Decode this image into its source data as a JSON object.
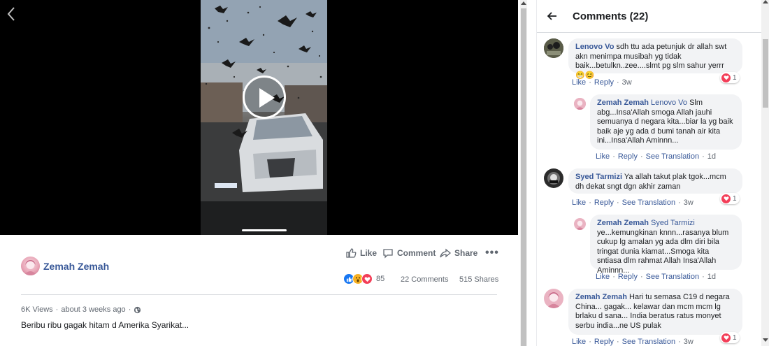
{
  "post": {
    "author": "Zemah Zemah",
    "actions": {
      "like": "Like",
      "comment": "Comment",
      "share": "Share"
    },
    "reaction_count": "85",
    "comments_count": "22 Comments",
    "shares_count": "515 Shares",
    "views": "6K Views",
    "time": "about 3 weeks ago",
    "caption": "Beribu ribu gagak hitam d Amerika Syarikat..."
  },
  "panel": {
    "title": "Comments (22)"
  },
  "comments": [
    {
      "author": "Lenovo Vo",
      "text": "sdh ttu ada petunjuk dr allah swt akn menimpa musibah yg tidak baik...betulkn..zee....slmt pg slm sahur yerrr 😁😊",
      "like": "Like",
      "reply": "Reply",
      "time": "3w",
      "reactions": "1"
    },
    {
      "author": "Zemah Zemah",
      "mention": "Lenovo Vo",
      "text": "Slm abg...Insa'Allah smoga Allah jauhi semuanya d negara kita...biar la yg baik baik aje yg ada d bumi tanah air kita ini...Insa'Allah Aminnn...",
      "like": "Like",
      "reply": "Reply",
      "translate": "See Translation",
      "time": "1d"
    },
    {
      "author": "Syed Tarmizi",
      "text": "Ya allah takut plak tgok...mcm dh dekat sngt dgn akhir zaman",
      "like": "Like",
      "reply": "Reply",
      "translate": "See Translation",
      "time": "3w",
      "reactions": "1"
    },
    {
      "author": "Zemah Zemah",
      "mention": "Syed Tarmizi",
      "text": "ye...kemungkinan knnn...rasanya blum cukup lg amalan yg ada dlm diri bila tringat dunia kiamat...Smoga kita sntiasa dlm rahmat Allah Insa'Allah Aminnn...",
      "like": "Like",
      "reply": "Reply",
      "translate": "See Translation",
      "time": "1d"
    },
    {
      "author": "Zemah Zemah",
      "text": "Hari tu semasa C19 d negara China... gagak... kelawar dan mcm mcm lg brlaku d sana... India beratus ratus monyet serbu india...ne US pulak",
      "like": "Like",
      "reply": "Reply",
      "translate": "See Translation",
      "time": "3w",
      "reactions": "1"
    }
  ],
  "icons": {
    "back": "chevron-left-icon",
    "play": "play-icon",
    "like": "thumbs-up-icon",
    "comment": "speech-bubble-icon",
    "share": "share-arrow-icon",
    "more": "more-dots-icon",
    "globe": "globe-icon",
    "heart": "heart-icon"
  },
  "colors": {
    "link": "#385898",
    "meta": "#606770",
    "bubble": "#f2f3f5",
    "heart": "#f33e58",
    "like_blue": "#1877f2"
  }
}
